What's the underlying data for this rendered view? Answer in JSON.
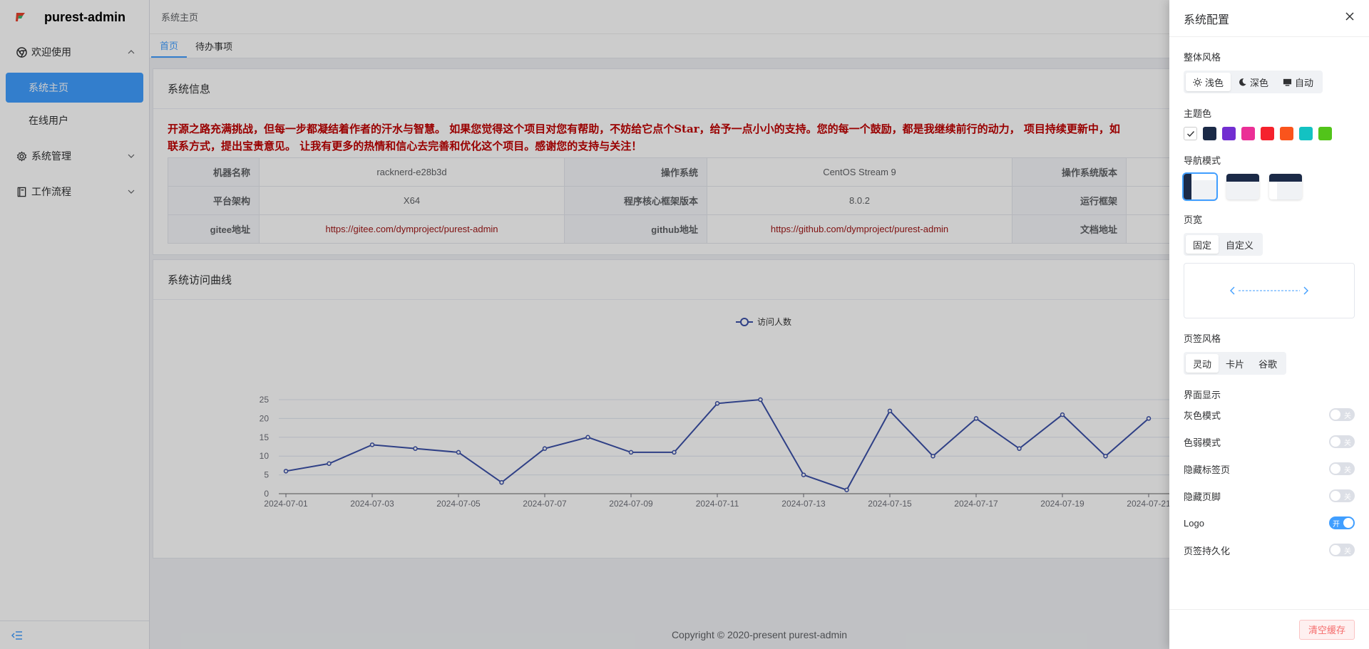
{
  "app": {
    "name": "purest-admin"
  },
  "sidebar": {
    "groups": [
      {
        "label": "欢迎使用",
        "expanded": true,
        "icon": "chrome-icon"
      },
      {
        "label": "系统管理",
        "expanded": false,
        "icon": "gear-icon"
      },
      {
        "label": "工作流程",
        "expanded": false,
        "icon": "book-icon"
      }
    ],
    "items": [
      {
        "label": "系统主页",
        "active": true
      },
      {
        "label": "在线用户",
        "active": false
      }
    ]
  },
  "topbar": {
    "breadcrumb": "系统主页"
  },
  "tabs": [
    {
      "label": "首页",
      "active": true
    },
    {
      "label": "待办事项",
      "active": false
    }
  ],
  "system_info": {
    "title": "系统信息",
    "notice_line1": "开源之路充满挑战，但每一步都凝结着作者的汗水与智慧。 如果您觉得这个项目对您有帮助，不妨给它点个Star，给予一点小小的支持。您的每一个鼓励，都是我继续前行的动力， 项目持续更新中，如",
    "notice_line2": "联系方式，提出宝贵意见。 让我有更多的热情和信心去完善和优化这个项目。感谢您的支持与关注！",
    "rows": [
      {
        "k1": "机器名称",
        "v1": "racknerd-e28b3d",
        "k2": "操作系统",
        "v2": "CentOS Stream 9",
        "k3": "操作系统版本"
      },
      {
        "k1": "平台架构",
        "v1": "X64",
        "k2": "程序核心框架版本",
        "v2": "8.0.2",
        "k3": "运行框架"
      },
      {
        "k1": "gitee地址",
        "v1": "https://gitee.com/dymproject/purest-admin",
        "k2": "github地址",
        "v2": "https://github.com/dymproject/purest-admin",
        "k3": "文档地址"
      }
    ]
  },
  "visits": {
    "title": "系统访问曲线"
  },
  "chart_data": {
    "type": "line",
    "x": [
      "2024-07-01",
      "2024-07-02",
      "2024-07-03",
      "2024-07-04",
      "2024-07-05",
      "2024-07-06",
      "2024-07-07",
      "2024-07-08",
      "2024-07-09",
      "2024-07-10",
      "2024-07-11",
      "2024-07-12",
      "2024-07-13",
      "2024-07-14",
      "2024-07-15",
      "2024-07-16",
      "2024-07-17",
      "2024-07-18",
      "2024-07-19",
      "2024-07-20",
      "2024-07-21"
    ],
    "x_tick_labels": [
      "2024-07-01",
      "2024-07-03",
      "2024-07-05",
      "2024-07-07",
      "2024-07-09",
      "2024-07-11",
      "2024-07-13",
      "2024-07-15",
      "2024-07-17",
      "2024-07-19",
      "2024-07-21"
    ],
    "series": [
      {
        "name": "访问人数",
        "values": [
          6,
          8,
          13,
          12,
          11,
          3,
          12,
          15,
          11,
          11,
          24,
          25,
          5,
          1,
          22,
          10,
          20,
          12,
          21,
          10,
          20
        ],
        "color": "#3b50a8"
      }
    ],
    "ylim": [
      0,
      25
    ],
    "y_ticks": [
      "0",
      "5",
      "10",
      "15",
      "20",
      "25"
    ],
    "grid": true,
    "legend": "top"
  },
  "footer": {
    "copyright": "Copyright © 2020-present purest-admin"
  },
  "settings": {
    "title": "系统配置",
    "overall_style": {
      "title": "整体风格",
      "options": [
        "浅色",
        "深色",
        "自动"
      ],
      "selected": "浅色"
    },
    "theme_color": {
      "title": "主题色",
      "colors": [
        "#ffffff",
        "#1b2a47",
        "#722ed1",
        "#eb2f96",
        "#f5222d",
        "#fa541c",
        "#13c2c2",
        "#52c41a"
      ]
    },
    "nav_mode": {
      "title": "导航模式"
    },
    "page_width": {
      "title": "页宽",
      "options": [
        "固定",
        "自定义"
      ],
      "selected": "固定"
    },
    "tab_style": {
      "title": "页签风格",
      "options": [
        "灵动",
        "卡片",
        "谷歌"
      ],
      "selected": "灵动"
    },
    "display": {
      "title": "界面显示",
      "toggles": [
        {
          "label": "灰色模式",
          "state": "关",
          "on": false
        },
        {
          "label": "色弱模式",
          "state": "关",
          "on": false
        },
        {
          "label": "隐藏标签页",
          "state": "关",
          "on": false
        },
        {
          "label": "隐藏页脚",
          "state": "关",
          "on": false
        },
        {
          "label": "Logo",
          "state": "开",
          "on": true
        },
        {
          "label": "页签持久化",
          "state": "关",
          "on": false
        }
      ]
    },
    "clear_cache": "清空缓存"
  }
}
